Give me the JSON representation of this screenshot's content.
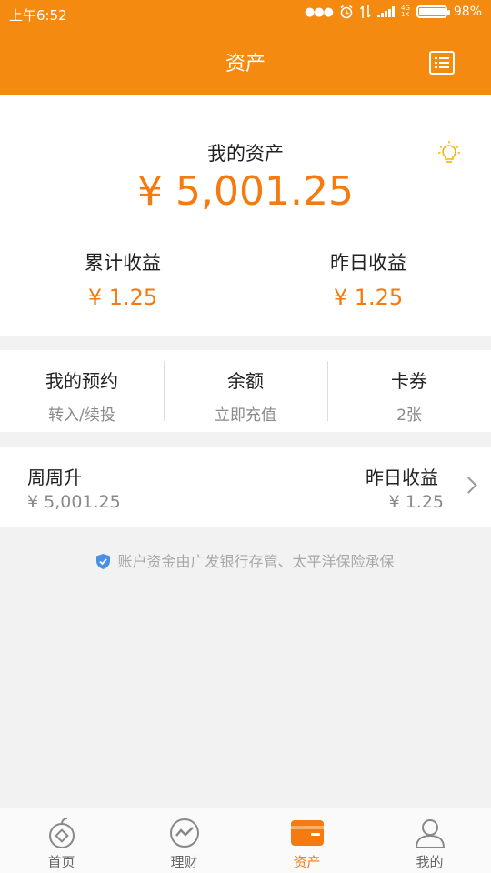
{
  "status_bar": {
    "time": "上午6:52",
    "network": "4G",
    "network_sub": "1X",
    "battery_text": "98%",
    "battery_level": 0.98
  },
  "nav": {
    "title": "资产",
    "menu_icon": "list-icon"
  },
  "asset_summary": {
    "title": "我的资产",
    "total": "¥ 5,001.25",
    "hint_icon": "lightbulb-icon",
    "cumulative_label": "累计收益",
    "cumulative_value": "¥ 1.25",
    "yesterday_label": "昨日收益",
    "yesterday_value": "¥ 1.25"
  },
  "quick_actions": [
    {
      "title": "我的预约",
      "subtitle": "转入/续投"
    },
    {
      "title": "余额",
      "subtitle": "立即充值"
    },
    {
      "title": "卡券",
      "subtitle": "2张"
    }
  ],
  "product": {
    "name": "周周升",
    "amount": "¥ 5,001.25",
    "income_label": "昨日收益",
    "income_value": "¥ 1.25"
  },
  "notice": {
    "icon": "shield-check-icon",
    "text": "账户资金由广发银行存管、太平洋保险承保"
  },
  "tabs": [
    {
      "label": "首页",
      "icon": "home-coin-icon",
      "active": false
    },
    {
      "label": "理财",
      "icon": "trend-icon",
      "active": false
    },
    {
      "label": "资产",
      "icon": "wallet-icon",
      "active": true
    },
    {
      "label": "我的",
      "icon": "user-icon",
      "active": false
    }
  ],
  "colors": {
    "brand": "#f58a10",
    "amount": "#f57a0f",
    "shield": "#4a90e2"
  }
}
